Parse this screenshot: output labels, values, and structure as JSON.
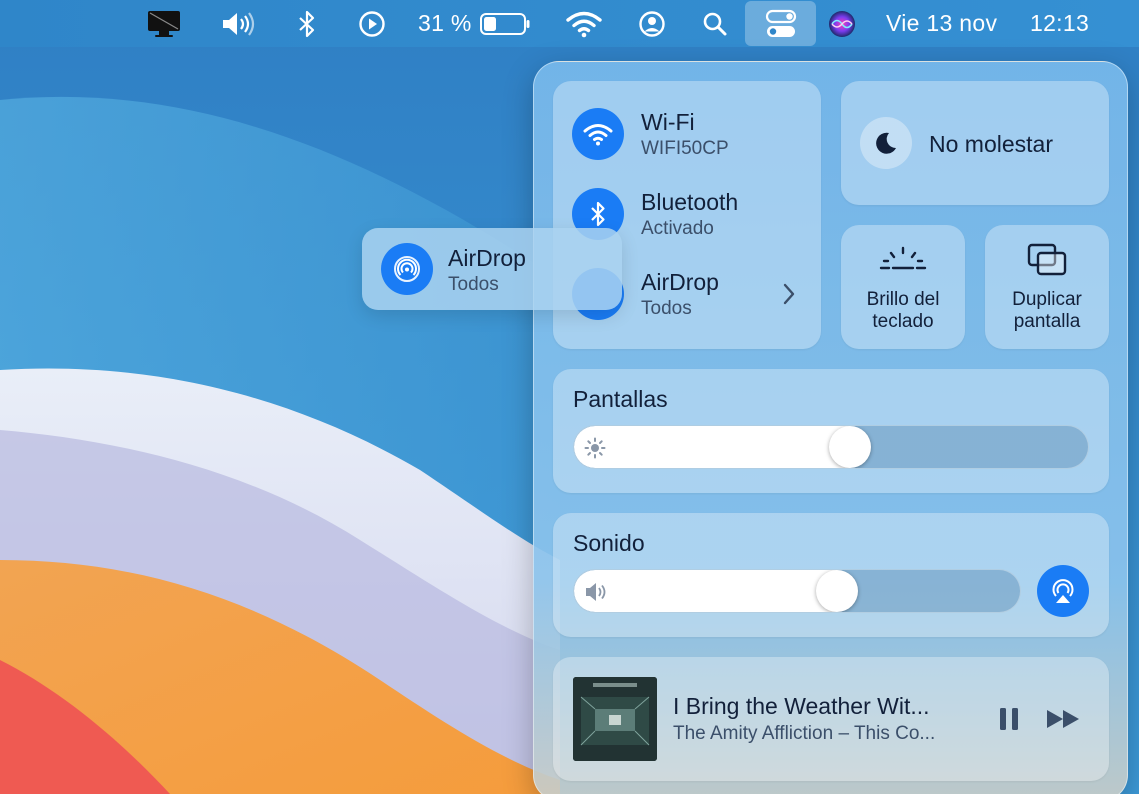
{
  "menubar": {
    "battery_percent": "31 %",
    "battery_level": 0.31,
    "date": "Vie 13 nov",
    "time": "12:13",
    "icons": [
      "display-icon",
      "volume-icon",
      "bluetooth-icon",
      "play-icon",
      "battery-icon",
      "wifi-icon",
      "user-icon",
      "search-icon",
      "control-center-icon",
      "siri-icon"
    ]
  },
  "control_center": {
    "wifi": {
      "title": "Wi-Fi",
      "subtitle": "WIFI50CP"
    },
    "bluetooth": {
      "title": "Bluetooth",
      "subtitle": "Activado"
    },
    "airdrop": {
      "title": "AirDrop",
      "subtitle": "Todos"
    },
    "do_not_disturb": {
      "label": "No molestar"
    },
    "keyboard_brightness": {
      "label": "Brillo del teclado"
    },
    "screen_mirroring": {
      "label": "Duplicar pantalla"
    },
    "display": {
      "title": "Pantallas",
      "level": 0.54
    },
    "sound": {
      "title": "Sonido",
      "level": 0.6
    },
    "now_playing": {
      "track": "I Bring the Weather Wit...",
      "artist": "The Amity Affliction – This Co..."
    }
  },
  "airdrop_drag": {
    "title": "AirDrop",
    "subtitle": "Todos"
  },
  "colors": {
    "accent": "#1a7cf5",
    "text": "#12203a"
  }
}
